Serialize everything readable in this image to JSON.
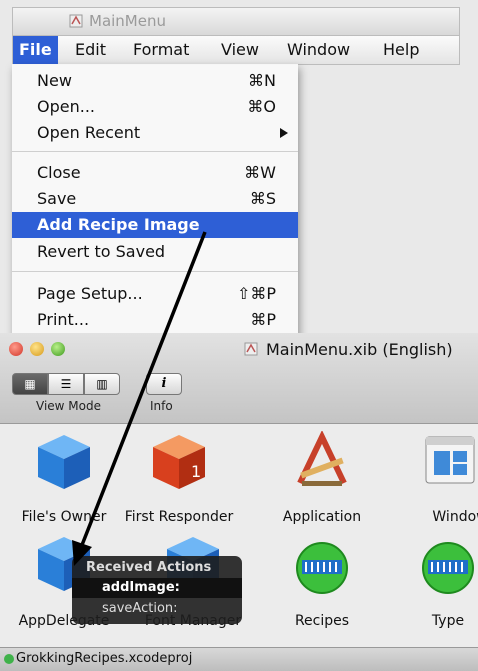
{
  "mainmenu_window": {
    "title": "MainMenu"
  },
  "menubar": {
    "items": [
      "File",
      "Edit",
      "Format",
      "View",
      "Window",
      "Help"
    ]
  },
  "file_menu": {
    "items": [
      {
        "label": "New",
        "shortcut": "⌘N"
      },
      {
        "label": "Open...",
        "shortcut": "⌘O"
      },
      {
        "label": "Open Recent",
        "shortcut": ""
      },
      {
        "label": "Close",
        "shortcut": "⌘W"
      },
      {
        "label": "Save",
        "shortcut": "⌘S"
      },
      {
        "label": "Add Recipe Image",
        "shortcut": ""
      },
      {
        "label": "Revert to Saved",
        "shortcut": ""
      },
      {
        "label": "Page Setup...",
        "shortcut": "⇧⌘P"
      },
      {
        "label": "Print...",
        "shortcut": "⌘P"
      }
    ],
    "highlighted": "Add Recipe Image"
  },
  "xib_window": {
    "title": "MainMenu.xib (English)",
    "toolbar": {
      "view_mode_label": "View Mode",
      "info_label": "Info",
      "info_glyph": "i"
    },
    "objects": [
      {
        "label": "File's Owner",
        "icon": "blue-cube-icon"
      },
      {
        "label": "First Responder",
        "icon": "red-cube-icon"
      },
      {
        "label": "Application",
        "icon": "application-icon"
      },
      {
        "label": "Window",
        "icon": "window-icon"
      },
      {
        "label": "AppDelegate",
        "icon": "blue-cube-icon"
      },
      {
        "label": "Font Manager",
        "icon": "blue-cube-icon"
      },
      {
        "label": "Recipes",
        "icon": "array-controller-icon"
      },
      {
        "label": "Type",
        "icon": "array-controller-icon"
      }
    ]
  },
  "actions_popup": {
    "header": "Received Actions",
    "items": [
      "addImage:",
      "saveAction:"
    ]
  },
  "statusbar": {
    "text": "GrokkingRecipes.xcodeproj"
  },
  "colors": {
    "highlight": "#2e5fd6",
    "cube_blue": "#2a7fd8",
    "cube_red": "#d8401e",
    "controller_green": "#3cbf3c"
  }
}
